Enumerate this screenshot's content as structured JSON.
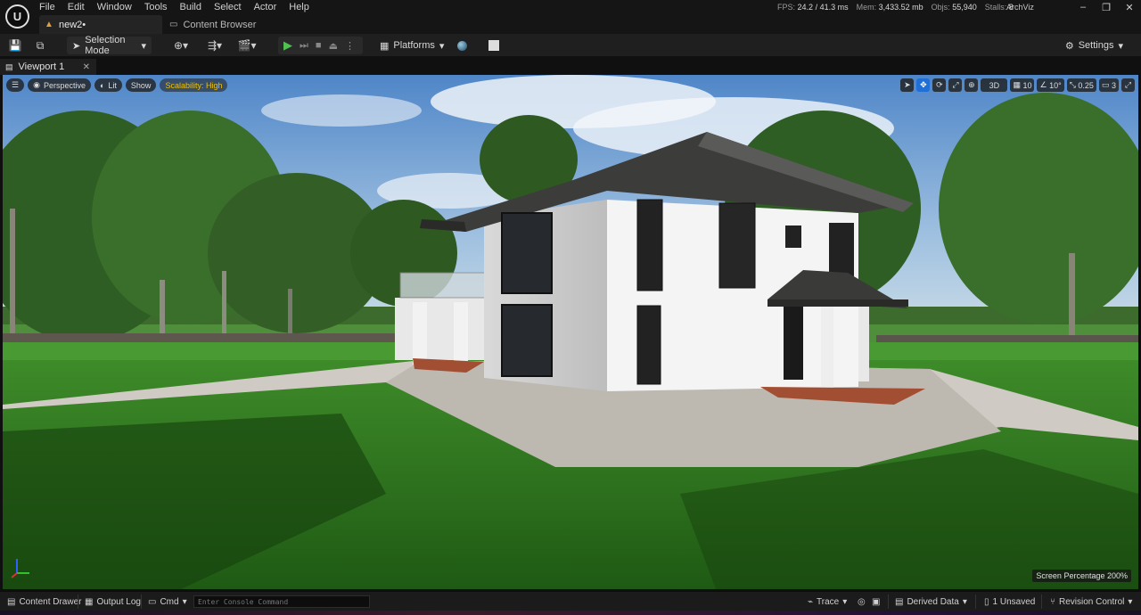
{
  "app": {
    "logo": "unreal-logo",
    "menu": [
      "File",
      "Edit",
      "Window",
      "Tools",
      "Build",
      "Select",
      "Actor",
      "Help"
    ],
    "document_tab": "new2•",
    "secondary_tab": "Content Browser",
    "project_name": "ArchViz"
  },
  "stats": {
    "fps_label": "FPS:",
    "fps_value": "24.2",
    "frame_ms": "/ 41.3 ms",
    "mem_label": "Mem:",
    "mem_value": "3,433.52 mb",
    "objs_label": "Objs:",
    "objs_value": "55,940",
    "stalls_label": "Stalls:",
    "stalls_value": "8"
  },
  "window_controls": {
    "minimize": "–",
    "restore": "❐",
    "close": "✕"
  },
  "toolbar": {
    "selection_mode": "Selection Mode",
    "platforms": "Platforms",
    "settings": "Settings"
  },
  "viewport_tab": {
    "label": "Viewport 1",
    "close": "✕"
  },
  "viewport": {
    "perspective": "Perspective",
    "lit": "Lit",
    "show": "Show",
    "scalability": "Scalability: High",
    "grid_snap": "10",
    "rotation_snap": "10°",
    "scale_snap": "0.25",
    "camera_speed": "3",
    "screen_percentage": "Screen Percentage  200%"
  },
  "statusbar": {
    "content_drawer": "Content Drawer",
    "output_log": "Output Log",
    "cmd": "Cmd",
    "console_placeholder": "Enter Console Command",
    "trace": "Trace",
    "derived_data": "Derived Data",
    "unsaved": "1 Unsaved",
    "revision_control": "Revision Control"
  },
  "colors": {
    "accent_blue": "#1f6fd6",
    "play_green": "#4fc24f",
    "scalability_yellow": "#f0c000"
  }
}
